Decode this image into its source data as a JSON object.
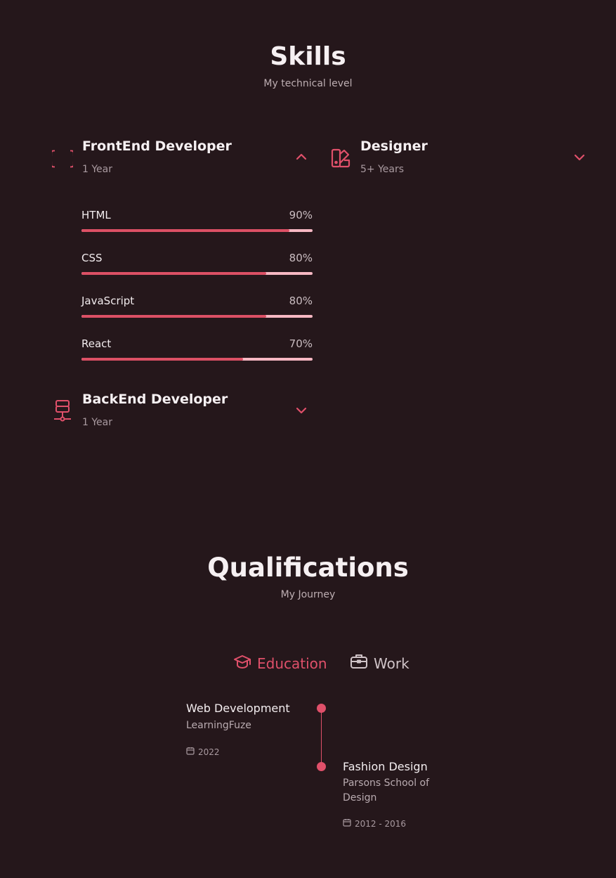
{
  "skills": {
    "title": "Skills",
    "subtitle": "My technical level",
    "groups": [
      {
        "title": "FrontEnd Developer",
        "subtitle": "1 Year",
        "icon": "code-braces-icon",
        "expanded": true,
        "items": [
          {
            "name": "HTML",
            "percent_label": "90%",
            "level": 0.9
          },
          {
            "name": "CSS",
            "percent_label": "80%",
            "level": 0.8
          },
          {
            "name": "JavaScript",
            "percent_label": "80%",
            "level": 0.8
          },
          {
            "name": "React",
            "percent_label": "70%",
            "level": 0.7
          }
        ]
      },
      {
        "title": "BackEnd Developer",
        "subtitle": "1 Year",
        "icon": "server-icon",
        "expanded": false
      },
      {
        "title": "Designer",
        "subtitle": "5+ Years",
        "icon": "swatchbook-icon",
        "expanded": false
      }
    ]
  },
  "qualifications": {
    "title": "Qualifications",
    "subtitle": "My Journey",
    "tabs": [
      {
        "label": "Education",
        "icon": "graduation-cap-icon",
        "active": true
      },
      {
        "label": "Work",
        "icon": "briefcase-icon",
        "active": false
      }
    ],
    "timeline": [
      {
        "title": "Web Development",
        "subtitle": "LearningFuze",
        "date": "2022",
        "side": "left"
      },
      {
        "title": "Fashion Design",
        "subtitle": "Parsons School of Design",
        "date": "2012 - 2016",
        "side": "right"
      }
    ]
  },
  "colors": {
    "background": "#25171b",
    "accent": "#e0506a",
    "bar_track": "#f7b8c3",
    "text": "#f4eef0",
    "muted": "#a99aa0"
  }
}
